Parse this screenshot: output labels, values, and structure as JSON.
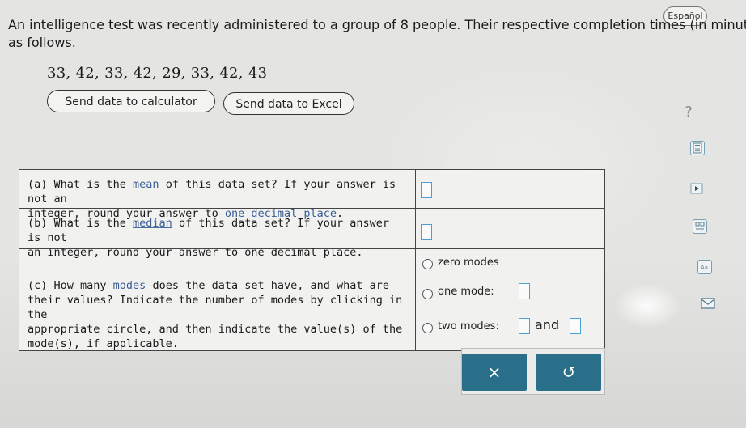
{
  "header": {
    "language_button": "Español"
  },
  "question": {
    "line1": "An intelligence test was recently administered to a group of 8 people. Their respective completion times (in minut",
    "line2": "as follows."
  },
  "dataset": "33, 42, 33, 42, 29, 33, 42, 43",
  "buttons": {
    "send_calculator": "Send data to calculator",
    "send_excel": "Send data to Excel"
  },
  "help_symbol": "?",
  "side_tools": [
    "calculator-icon",
    "play-icon",
    "grid-icon",
    "font-icon",
    "mail-icon"
  ],
  "table": {
    "a": {
      "prefix": "(a) What is the ",
      "link": "mean",
      "mid": " of this data set? If your answer is not an",
      "line2_pre": "integer, round your answer to ",
      "line2_link": "one decimal place",
      "line2_post": "."
    },
    "b": {
      "prefix": "(b) What is the ",
      "link": "median",
      "mid": " of this data set? If your answer is not",
      "line2": "an integer, round your answer to one decimal place."
    },
    "c": {
      "prefix": "(c) How many ",
      "link": "modes",
      "mid": " does the data set have, and what are",
      "line2": "their values? Indicate the number of modes by clicking in the",
      "line3": "appropriate circle, and then indicate the value(s) of the",
      "line4": "mode(s), if applicable."
    },
    "options": {
      "zero": "zero modes",
      "one": "one mode:",
      "two": "two modes:",
      "and": "and"
    }
  },
  "actions": {
    "clear": "×",
    "undo": "↺"
  }
}
